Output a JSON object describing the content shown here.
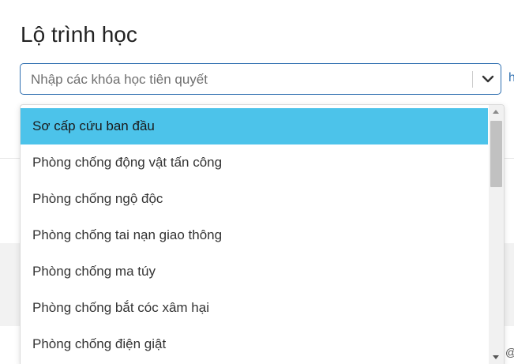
{
  "page": {
    "title": "Lộ trình học"
  },
  "prerequisite_select": {
    "placeholder": "Nhập các khóa học tiên quyết",
    "icon": "chevron-down-icon",
    "side_link_fragment": "h",
    "side_text_fragment": "@"
  },
  "dropdown": {
    "selected_index": 0,
    "options": [
      "Sơ cấp cứu ban đầu",
      "Phòng chống động vật tấn công",
      "Phòng chống ngộ độc",
      "Phòng chống tai nạn giao thông",
      "Phòng chống ma túy",
      "Phòng chống bắt cóc xâm hại",
      "Phòng chống điện giật"
    ]
  },
  "colors": {
    "selected_option": "#4cc3ea",
    "select_border": "#2f6fb0"
  }
}
